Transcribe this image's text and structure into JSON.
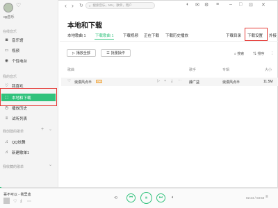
{
  "user": {
    "name_label": "qq音乐"
  },
  "sidebar": {
    "section_online": "在线音乐",
    "items_online": [
      {
        "label": "音乐馆",
        "icon": "music-hall-icon"
      },
      {
        "label": "视频",
        "icon": "video-icon"
      },
      {
        "label": "个性电台",
        "icon": "radio-icon"
      }
    ],
    "section_mine": "我的音乐",
    "items_mine": [
      {
        "label": "我喜欢",
        "icon": "heart-icon"
      },
      {
        "label": "本地和下载",
        "icon": "download-icon"
      },
      {
        "label": "播放历史",
        "icon": "history-icon"
      },
      {
        "label": "试听列表",
        "icon": "list-icon"
      }
    ],
    "section_created": "我创建的歌单",
    "items_created": [
      {
        "label": "QQ炫舞",
        "icon": "playlist-icon"
      },
      {
        "label": "新建歌单1",
        "icon": "playlist-icon"
      }
    ],
    "section_collected": "我收藏的歌单"
  },
  "topbar": {
    "search_placeholder": "搜索音乐，MV，歌单，用户"
  },
  "main": {
    "title": "本地和下载",
    "tabs": [
      "本地歌曲 1",
      "下载歌曲 1",
      "下载视频",
      "正在下载",
      "下载历史播放"
    ],
    "links": [
      "下载目录",
      "下载设置",
      "外接"
    ],
    "btn_play_all": "播放全部",
    "btn_batch": "批量操作",
    "btn_search": "搜索",
    "btn_sort": "排序"
  },
  "table": {
    "headers": [
      "歌曲",
      "歌手",
      "专辑",
      "大小"
    ],
    "rows": [
      {
        "title": "浪漫风点半",
        "quality": "HQ",
        "artist": "薛广益",
        "album": "浪漫风点半",
        "size": "11.5M"
      }
    ]
  },
  "player": {
    "song": "哥不可以 - 我里迪",
    "time": "02:24 / 03:50"
  },
  "colors": {
    "accent": "#31c27c",
    "highlight_box": "#e53935"
  }
}
